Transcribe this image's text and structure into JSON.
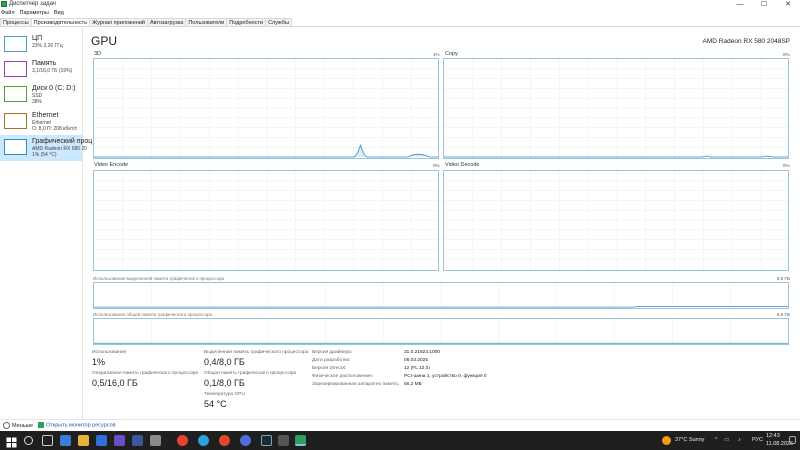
{
  "window": {
    "title": "Диспетчер задач",
    "minimize": "—",
    "maximize": "☐",
    "close": "✕"
  },
  "menu": [
    "Файл",
    "Параметры",
    "Вид"
  ],
  "tabs": [
    "Процессы",
    "Производительность",
    "Журнал приложений",
    "Автозагрузка",
    "Пользователи",
    "Подробности",
    "Службы"
  ],
  "sidebar": [
    {
      "name": "ЦП",
      "sub1": "23% 3,26 ГГц",
      "sub2": ""
    },
    {
      "name": "Память",
      "sub1": "3,1/16,0 ГБ (19%)",
      "sub2": ""
    },
    {
      "name": "Диск 0 (C: D:)",
      "sub1": "SSD",
      "sub2": "38%"
    },
    {
      "name": "Ethernet",
      "sub1": "Ethernet",
      "sub2": "О: 8,0  П: 208 кбит/с"
    },
    {
      "name": "Графический проц",
      "sub1": "AMD Radeon RX 580 20",
      "sub2": "1% (54 °C)"
    }
  ],
  "gpu": {
    "title": "GPU",
    "model": "AMD Radeon RX 580 2048SP",
    "graphs": [
      {
        "label": "3D",
        "max": "1%"
      },
      {
        "label": "Copy",
        "max": "0%"
      },
      {
        "label": "Video Encode",
        "max": "0%"
      },
      {
        "label": "Video Decode",
        "max": "0%"
      }
    ],
    "dedicated_label": "Использование выделенной памяти графического процессора",
    "dedicated_max": "8,0 ГБ",
    "shared_label": "Использование общей памяти графического процессора",
    "shared_max": "8,0 ГБ"
  },
  "stats": {
    "utilization_label": "Использование",
    "utilization_value": "1%",
    "gpu_memory_label": "Оперативная память графического процессора",
    "gpu_memory_value": "0,5/16,0 ГБ",
    "dedicated_label": "Выделенная память графического процессора",
    "dedicated_value": "0,4/8,0 ГБ",
    "shared_label": "Общая память графического процессора",
    "shared_value": "0,1/8,0 ГБ",
    "temp_label": "Температура GPU",
    "temp_value": "54 °C"
  },
  "info": [
    {
      "label": "Версия драйвера:",
      "value": "31.0.21923.1000"
    },
    {
      "label": "Дата разработки:",
      "value": "06.03.2025"
    },
    {
      "label": "Версия DirectX:",
      "value": "12 (FL 12.0)"
    },
    {
      "label": "Физическое расположение:",
      "value": "PCI-шина 1, устройство 0, функция 0"
    },
    {
      "label": "Зарезервированная аппаратно память:",
      "value": "56,2 МБ"
    }
  ],
  "footer": {
    "less": "Меньше",
    "open_monitor": "Открыть монитор ресурсов"
  },
  "taskbar": {
    "weather": "37°C  Sunny",
    "lang": "РУС",
    "time": "12:43",
    "date": "11.08.2026"
  },
  "colors": {
    "accent": "#cce8ff",
    "graph_border": "#9dc3d6",
    "graph_line": "#2b8fc6"
  }
}
